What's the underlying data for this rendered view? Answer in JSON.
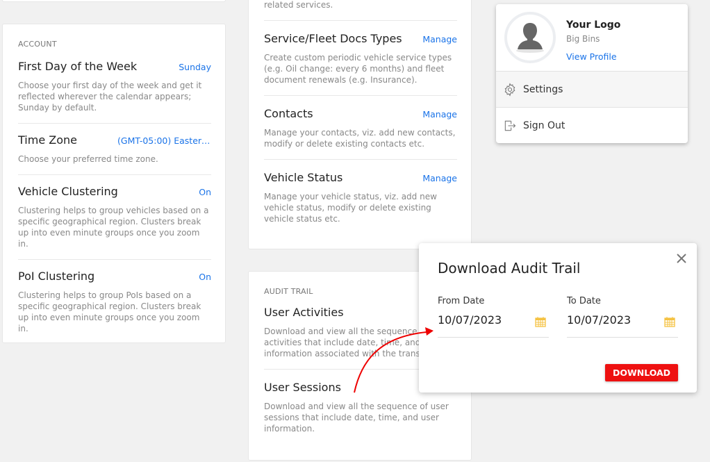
{
  "account": {
    "section": "ACCOUNT",
    "items": [
      {
        "title": "First Day of the Week",
        "value": "Sunday",
        "desc": "Choose your first day of the week and get it reflected wherever the calendar appears; Sunday by default."
      },
      {
        "title": "Time Zone",
        "value": "(GMT-05:00) Eastern ...",
        "desc": "Choose your preferred time zone."
      },
      {
        "title": "Vehicle Clustering",
        "value": "On",
        "desc": "Clustering helps to group vehicles based on a specific geographical region. Clusters break up into even minute groups once you zoom in."
      },
      {
        "title": "PoI Clustering",
        "value": "On",
        "desc": "Clustering helps to group PoIs based on a specific geographical region. Clusters break up into even minute groups once you zoom in."
      }
    ]
  },
  "manage": {
    "top_desc": "related services.",
    "items": [
      {
        "title": "Service/Fleet Docs Types",
        "action": "Manage",
        "desc": "Create custom periodic vehicle service types (e.g. Oil change: every 6 months) and fleet document renewals (e.g. Insurance)."
      },
      {
        "title": "Contacts",
        "action": "Manage",
        "desc": "Manage your contacts, viz. add new contacts, modify or delete existing contacts etc."
      },
      {
        "title": "Vehicle Status",
        "action": "Manage",
        "desc": "Manage your vehicle status, viz. add new vehicle status, modify or delete existing vehicle status etc."
      }
    ]
  },
  "audit": {
    "section": "AUDIT TRAIL",
    "items": [
      {
        "title": "User Activities",
        "desc": "Download and view all the sequence of user activities that include date, time, and user information associated with the transaction."
      },
      {
        "title": "User Sessions",
        "desc": "Download and view all the sequence of user sessions that include date, time, and user information."
      }
    ]
  },
  "profile": {
    "name": "Your Logo",
    "company": "Big Bins",
    "view_profile": "View Profile",
    "settings": "Settings",
    "sign_out": "Sign Out"
  },
  "modal": {
    "title": "Download Audit Trail",
    "from_label": "From Date",
    "from_value": "10/07/2023",
    "to_label": "To Date",
    "to_value": "10/07/2023",
    "download": "DOWNLOAD"
  },
  "colors": {
    "link": "#1a73e8",
    "download": "#ee1111",
    "calendar": "#f5c242",
    "arrow": "#ee0000"
  }
}
